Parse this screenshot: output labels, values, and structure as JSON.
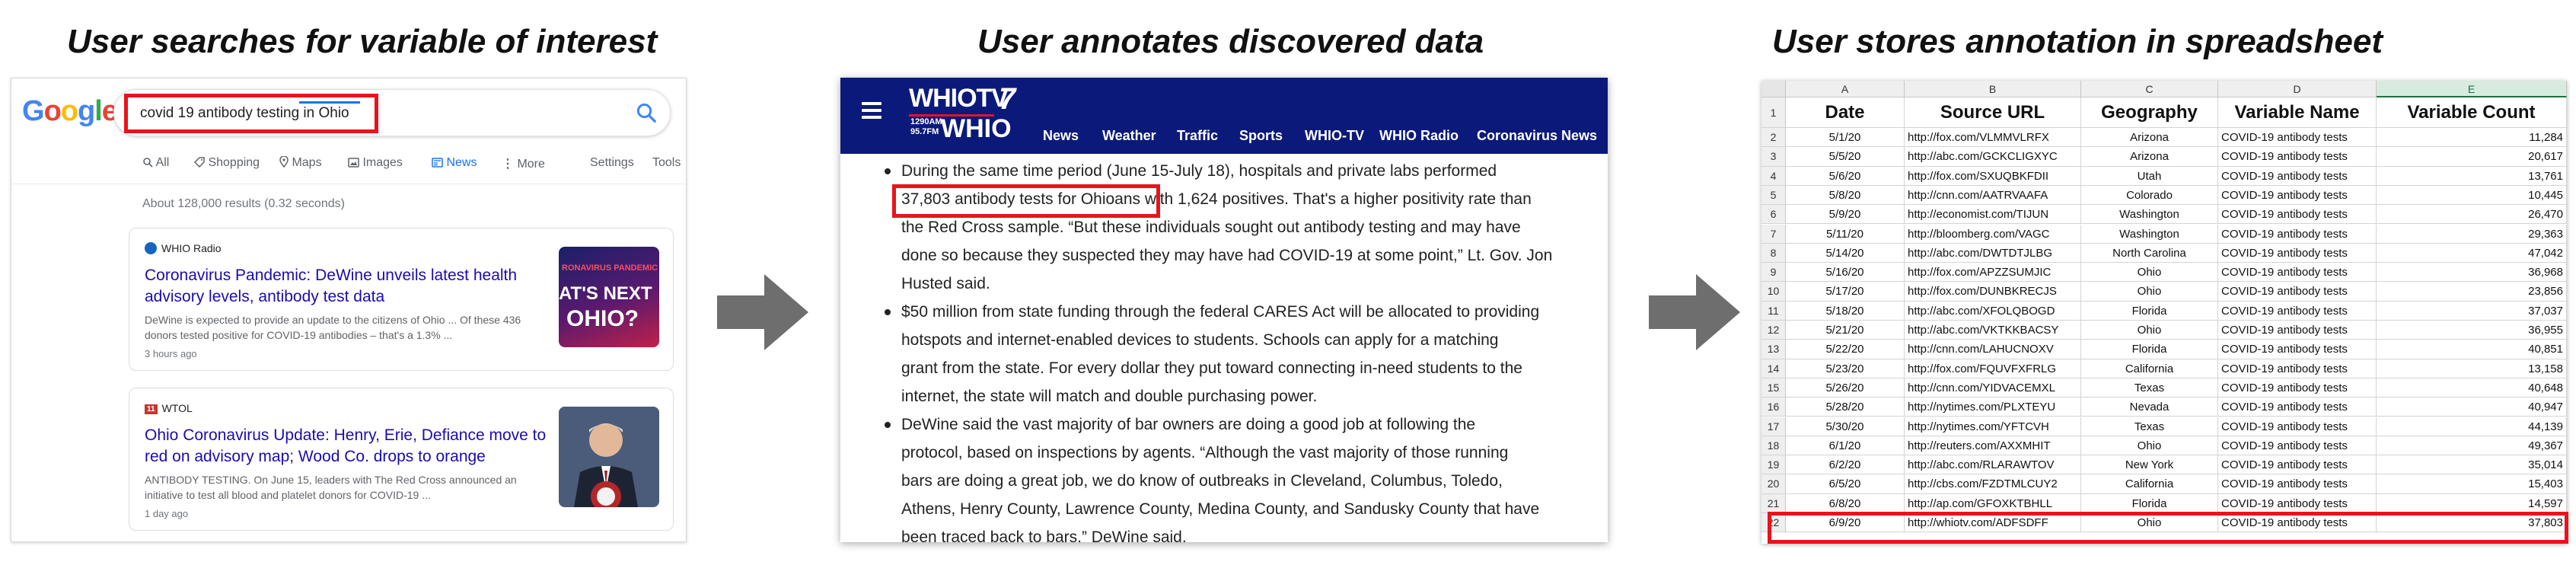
{
  "titles": {
    "search": "User searches for variable of interest",
    "annotate": "User annotates discovered data",
    "store": "User stores annotation in spreadsheet"
  },
  "google": {
    "logo_letters": [
      {
        "ch": "G",
        "color": "#4285f4"
      },
      {
        "ch": "o",
        "color": "#ea4335"
      },
      {
        "ch": "o",
        "color": "#fbbc05"
      },
      {
        "ch": "g",
        "color": "#4285f4"
      },
      {
        "ch": "l",
        "color": "#34a853"
      },
      {
        "ch": "e",
        "color": "#ea4335"
      }
    ],
    "search_query": "covid 19 antibody testing in Ohio",
    "tabs": [
      "All",
      "Shopping",
      "Maps",
      "Images",
      "News",
      "More",
      "Settings",
      "Tools"
    ],
    "active_tab": "News",
    "result_stats": "About 128,000 results (0.32 seconds)",
    "results": [
      {
        "source": "WHIO Radio",
        "headline": "Coronavirus Pandemic: DeWine unveils latest health advisory levels, antibody test data",
        "snippet": "DeWine is expected to provide an update to the citizens of Ohio ... Of these 436 donors tested positive for COVID-19 antibodies – that's a 1.3% ...",
        "time": "3 hours ago",
        "thumb_text_1": "RONAVIRUS PANDEMIC",
        "thumb_text_2": "AT'S NEXT",
        "thumb_text_3": "OHIO?"
      },
      {
        "source": "WTOL",
        "headline": "Ohio Coronavirus Update: Henry, Erie, Defiance move to red on advisory map; Wood Co. drops to orange",
        "snippet": "ANTIBODY TESTING. On June 15, leaders with The Red Cross announced an initiative to test all blood and platelet donors for COVID-19 ...",
        "time": "1 day ago",
        "source_badge": "11"
      }
    ]
  },
  "whio": {
    "logo_tv": "WHIOTV",
    "logo_channel": "7",
    "logo_freq_1": "1290AM",
    "logo_freq_2": "95.7FM",
    "logo_radio": "WHIO",
    "nav": [
      "News",
      "Weather",
      "Traffic",
      "Sports",
      "WHIO-TV",
      "WHIO Radio",
      "Coronavirus News"
    ],
    "p1_l1": "During the same time period (June 15-July 18), hospitals and private labs performed",
    "p1_highlight": "37,803 antibody tests for Ohioans",
    "p1_l2_rest": " with 1,624 positives. That's a higher positivity rate than",
    "p1_l3": "the Red Cross sample. “But these individuals sought out antibody testing and may have",
    "p1_l4": "done so because they suspected they may have had COVID-19 at some point,” Lt. Gov. Jon",
    "p1_l5": "Husted said.",
    "p2": [
      "$50 million from state funding through the federal CARES Act will be allocated to providing",
      "hotspots and internet-enabled devices to students. Schools can apply for a matching",
      "grant from the state. For every dollar they put toward connecting in-need students to the",
      "internet, the state will match and double purchasing power."
    ],
    "p3": [
      "DeWine said the vast majority of bar owners are doing a good job at following the",
      "protocol, based on inspections by agents. “Although the vast majority of those running",
      "bars are doing a great job, we do know of outbreaks in Cleveland, Columbus, Toledo,",
      "Athens, Henry County, Lawrence County, Medina County, and Sandusky County that have",
      "been traced back to bars,” DeWine said."
    ]
  },
  "sheet": {
    "col_letters": [
      "A",
      "B",
      "C",
      "D",
      "E"
    ],
    "headers": [
      "Date",
      "Source URL",
      "Geography",
      "Variable Name",
      "Variable Count"
    ],
    "rows": [
      [
        "5/1/20",
        "http://fox.com/VLMMVLRFX",
        "Arizona",
        "COVID-19 antibody tests",
        "11,284"
      ],
      [
        "5/5/20",
        "http://abc.com/GCKCLIGXYC",
        "Arizona",
        "COVID-19 antibody tests",
        "20,617"
      ],
      [
        "5/6/20",
        "http://fox.com/SXUQBKFDII",
        "Utah",
        "COVID-19 antibody tests",
        "13,761"
      ],
      [
        "5/8/20",
        "http://cnn.com/AATRVAAFA",
        "Colorado",
        "COVID-19 antibody tests",
        "10,445"
      ],
      [
        "5/9/20",
        "http://economist.com/TIJUN",
        "Washington",
        "COVID-19 antibody tests",
        "26,470"
      ],
      [
        "5/11/20",
        "http://bloomberg.com/VAGC",
        "Washington",
        "COVID-19 antibody tests",
        "29,363"
      ],
      [
        "5/14/20",
        "http://abc.com/DWTDTJLBG",
        "North Carolina",
        "COVID-19 antibody tests",
        "47,042"
      ],
      [
        "5/16/20",
        "http://fox.com/APZZSUMJIC",
        "Ohio",
        "COVID-19 antibody tests",
        "36,968"
      ],
      [
        "5/17/20",
        "http://fox.com/DUNBKRECJS",
        "Ohio",
        "COVID-19 antibody tests",
        "23,856"
      ],
      [
        "5/18/20",
        "http://abc.com/XFOLQBOGD",
        "Florida",
        "COVID-19 antibody tests",
        "37,037"
      ],
      [
        "5/21/20",
        "http://abc.com/VKTKKBACSY",
        "Ohio",
        "COVID-19 antibody tests",
        "36,955"
      ],
      [
        "5/22/20",
        "http://cnn.com/LAHUCNOXV",
        "Florida",
        "COVID-19 antibody tests",
        "40,851"
      ],
      [
        "5/23/20",
        "http://fox.com/FQUVFXFRLG",
        "California",
        "COVID-19 antibody tests",
        "13,158"
      ],
      [
        "5/26/20",
        "http://cnn.com/YIDVACEMXL",
        "Texas",
        "COVID-19 antibody tests",
        "40,648"
      ],
      [
        "5/28/20",
        "http://nytimes.com/PLXTEYU",
        "Nevada",
        "COVID-19 antibody tests",
        "40,947"
      ],
      [
        "5/30/20",
        "http://nytimes.com/YFTCVH",
        "Texas",
        "COVID-19 antibody tests",
        "44,139"
      ],
      [
        "6/1/20",
        "http://reuters.com/AXXMHIT",
        "Ohio",
        "COVID-19 antibody tests",
        "49,367"
      ],
      [
        "6/2/20",
        "http://abc.com/RLARAWTOV",
        "New York",
        "COVID-19 antibody tests",
        "35,014"
      ],
      [
        "6/5/20",
        "http://cbs.com/FZDTMLCUY2",
        "California",
        "COVID-19 antibody tests",
        "15,403"
      ],
      [
        "6/8/20",
        "http://ap.com/GFOXKTBHLL",
        "Florida",
        "COVID-19 antibody tests",
        "14,597"
      ],
      [
        "6/9/20",
        "http://whiotv.com/ADFSDFF",
        "Ohio",
        "COVID-19 antibody tests",
        "37,803"
      ]
    ]
  },
  "colors": {
    "highlight_red": "#e8141c",
    "whio_blue": "#0b1a7a",
    "google_link": "#1a0dab",
    "arrow_gray": "#6e6e6e"
  }
}
